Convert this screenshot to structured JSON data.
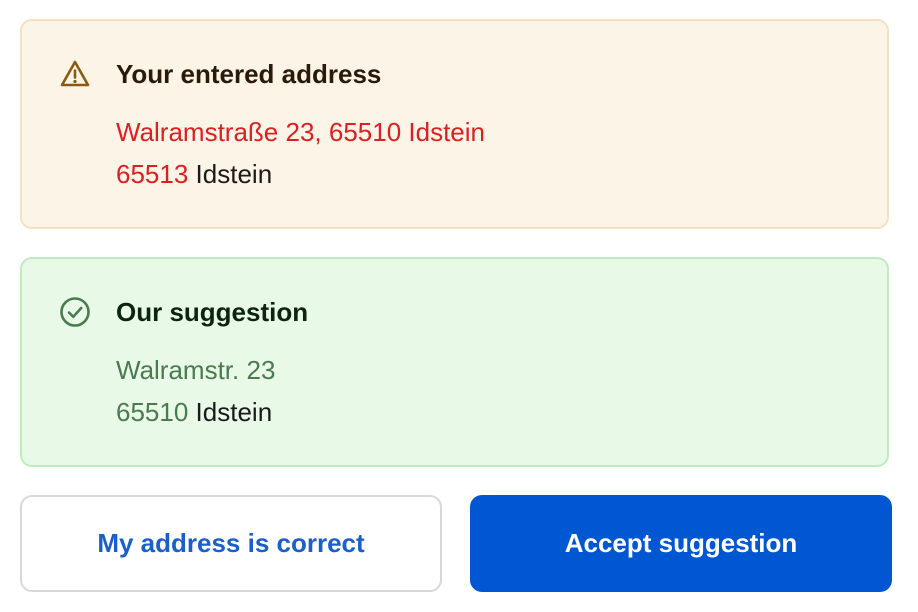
{
  "entered": {
    "title": "Your entered address",
    "icon": "warning-triangle-icon",
    "street": "Walramstraße 23, 65510 Idstein",
    "postal_code": "65513",
    "city": "Idstein",
    "colors": {
      "background": "#fdf4e8",
      "border": "#f6e0c2",
      "error_text": "#dc1f1f",
      "icon": "#8a5a10"
    }
  },
  "suggestion": {
    "title": "Our suggestion",
    "icon": "check-circle-icon",
    "street": "Walramstr. 23",
    "postal_code": "65510",
    "city": "Idstein",
    "colors": {
      "background": "#e8f9e8",
      "border": "#bfebbf",
      "highlight_text": "#4a7a4e",
      "icon": "#4a7a4e"
    }
  },
  "actions": {
    "keep_label": "My address is correct",
    "accept_label": "Accept suggestion",
    "primary_color": "#0057d1",
    "link_color": "#1a5fcc"
  }
}
